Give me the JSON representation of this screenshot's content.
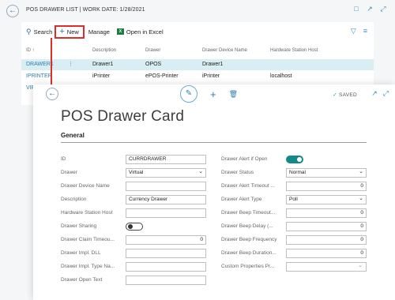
{
  "list_page": {
    "title": "POS DRAWER LIST | WORK DATE: 1/28/2021",
    "toolbar": {
      "search_label": "Search",
      "new_label": "New",
      "manage_label": "Manage",
      "excel_label": "Open in Excel"
    },
    "columns": [
      "ID ↑",
      "Description",
      "Drawer",
      "Drawer Device Name",
      "Hardware Station Host"
    ],
    "rows": [
      {
        "id": "DRAWER1",
        "description": "Drawer1",
        "drawer": "OPOS",
        "device_name": "Drawer1",
        "host": ""
      },
      {
        "id": "IPRINTER",
        "description": "iPrinter",
        "drawer": "ePOS-Printer",
        "device_name": "iPrinter",
        "host": "localhost"
      },
      {
        "id": "VIRT",
        "description": "",
        "drawer": "",
        "device_name": "",
        "host": ""
      }
    ]
  },
  "card": {
    "status": "SAVED",
    "title": "POS Drawer Card",
    "section": "General",
    "left_fields": [
      {
        "label": "ID",
        "value": "CURRDRAWER",
        "kind": "text"
      },
      {
        "label": "Drawer",
        "value": "Virtual",
        "kind": "select"
      },
      {
        "label": "Drawer Device Name",
        "value": "",
        "kind": "text"
      },
      {
        "label": "Description",
        "value": "Currency Drawer",
        "kind": "text"
      },
      {
        "label": "Hardware Station Host",
        "value": "",
        "kind": "text"
      },
      {
        "label": "Drawer Sharing",
        "value": "off",
        "kind": "toggle"
      },
      {
        "label": "Drawer Claim Timeou...",
        "value": "0",
        "kind": "number"
      },
      {
        "label": "Drawer Impl. DLL",
        "value": "",
        "kind": "text"
      },
      {
        "label": "Drawer Impl. Type Na...",
        "value": "",
        "kind": "text"
      },
      {
        "label": "Drawer Open Text",
        "value": "",
        "kind": "text"
      }
    ],
    "right_fields": [
      {
        "label": "Drawer Alert if Open",
        "value": "on",
        "kind": "toggle"
      },
      {
        "label": "Drawer Status",
        "value": "Normal",
        "kind": "select"
      },
      {
        "label": "Drawer Alert Timeout ...",
        "value": "0",
        "kind": "number"
      },
      {
        "label": "Drawer Alert Type",
        "value": "Poll",
        "kind": "select"
      },
      {
        "label": "Drawer Beep Timeout...",
        "value": "0",
        "kind": "number"
      },
      {
        "label": "Drawer Beep Delay (...",
        "value": "0",
        "kind": "number"
      },
      {
        "label": "Drawer Beep Frequency",
        "value": "0",
        "kind": "number"
      },
      {
        "label": "Drawer Beep Duration...",
        "value": "0",
        "kind": "number"
      },
      {
        "label": "Custom Properties Pr...",
        "value": "",
        "kind": "lookup"
      }
    ]
  },
  "colors": {
    "accent": "#2b7fb0",
    "selected_row": "#d8eef2",
    "toggle_on": "#138a8a",
    "annotation_red": "#e02b2b"
  }
}
